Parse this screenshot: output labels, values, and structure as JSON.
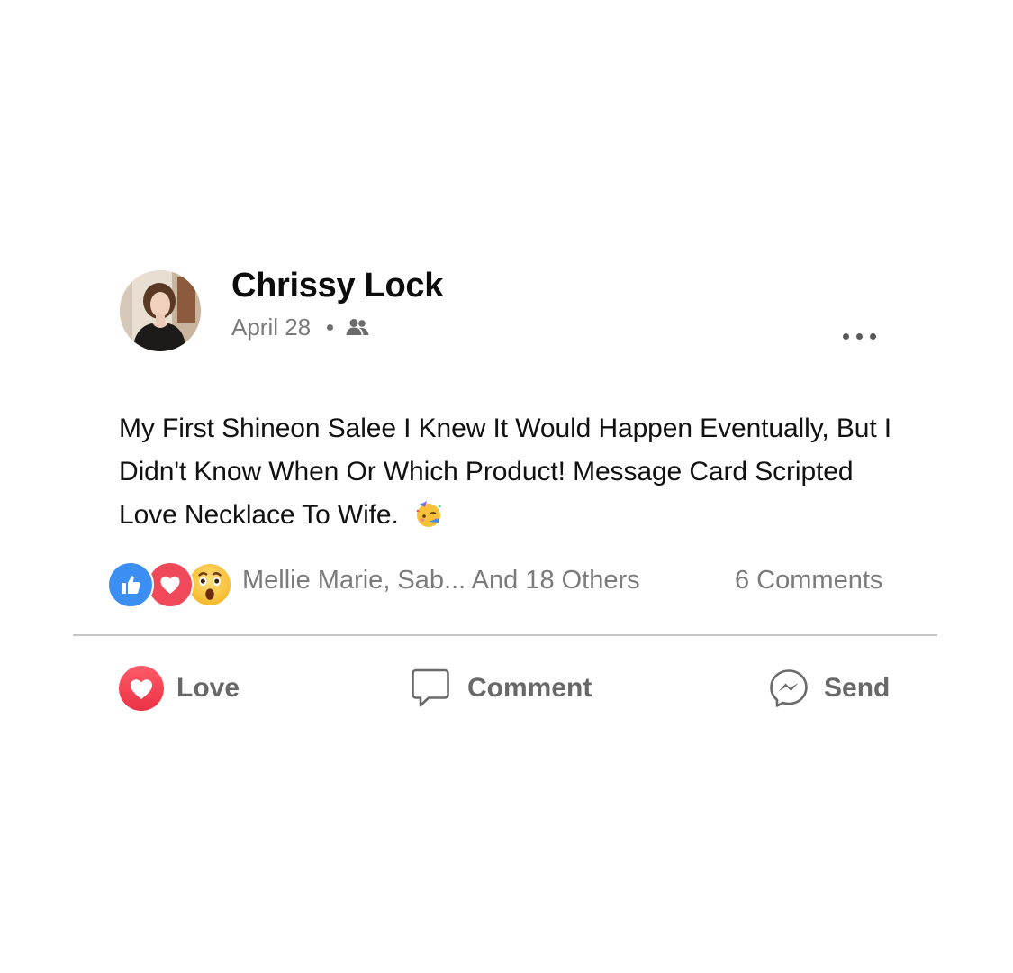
{
  "post": {
    "author": "Chrissy Lock",
    "date": "April 28",
    "audience_icon": "friends-icon",
    "more_icon": "more-options-icon",
    "text": "My First Shineon Salee I Knew It Would Happen Eventually, But I Didn't Know When Or Which Product! Message Card Scripted Love Necklace To Wife.",
    "text_emoji": "🥳"
  },
  "reactions": {
    "icons": [
      "like-reaction-icon",
      "love-reaction-icon",
      "wow-reaction-icon"
    ],
    "names": "Mellie Marie, Sab... And 18 Others",
    "comments": "6 Comments"
  },
  "actions": {
    "love_label": "Love",
    "comment_label": "Comment",
    "send_label": "Send"
  },
  "colors": {
    "like_blue": "#3b8ef2",
    "love_red": "#f04a5a",
    "secondary_text": "#7b7b7b",
    "action_text": "#686868",
    "divider": "#c7c7c7"
  }
}
